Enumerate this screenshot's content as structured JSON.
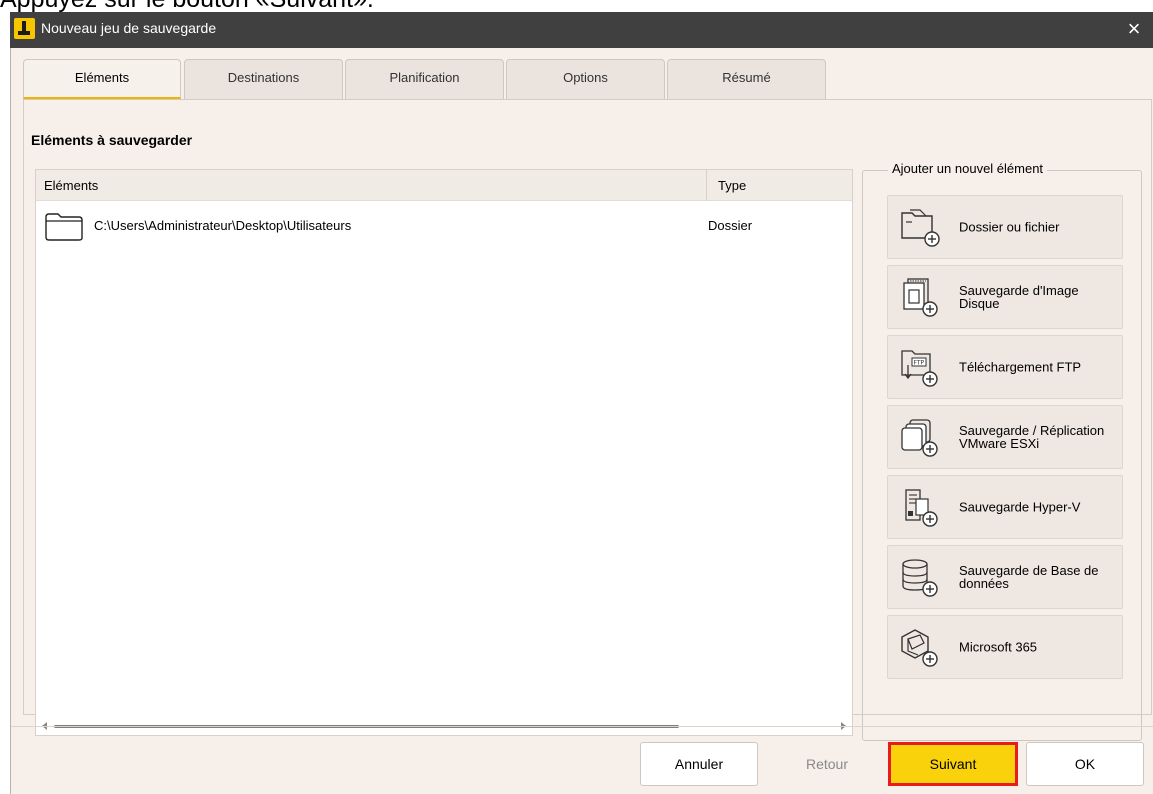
{
  "caption": "Appuyez sur le bouton «Suivant».",
  "window": {
    "title": "Nouveau jeu de sauvegarde",
    "close": "×"
  },
  "tabs": [
    {
      "label": "Eléments",
      "active": true
    },
    {
      "label": "Destinations"
    },
    {
      "label": "Planification"
    },
    {
      "label": "Options"
    },
    {
      "label": "Résumé"
    }
  ],
  "section_title": "Eléments à sauvegarder",
  "list": {
    "headers": {
      "elements": "Eléments",
      "type": "Type"
    },
    "rows": [
      {
        "path": "C:\\Users\\Administrateur\\Desktop\\Utilisateurs",
        "type": "Dossier",
        "icon": "folder-icon"
      }
    ]
  },
  "add_group": {
    "title": "Ajouter un nouvel élément",
    "items": [
      {
        "label": "Dossier ou fichier",
        "icon": "file-add-icon"
      },
      {
        "label": "Sauvegarde d'Image Disque",
        "icon": "disk-image-add-icon"
      },
      {
        "label": "Téléchargement FTP",
        "icon": "ftp-add-icon"
      },
      {
        "label": "Sauvegarde / Réplication VMware ESXi",
        "icon": "vmware-add-icon"
      },
      {
        "label": "Sauvegarde Hyper-V",
        "icon": "hyperv-add-icon"
      },
      {
        "label": "Sauvegarde de Base de données",
        "icon": "database-add-icon"
      },
      {
        "label": "Microsoft 365",
        "icon": "microsoft365-add-icon"
      }
    ]
  },
  "buttons": {
    "cancel": "Annuler",
    "back": "Retour",
    "next": "Suivant",
    "ok": "OK"
  },
  "colors": {
    "titlebar": "#404040",
    "accent": "#f9d20b",
    "highlight_border": "#e91c1c"
  }
}
